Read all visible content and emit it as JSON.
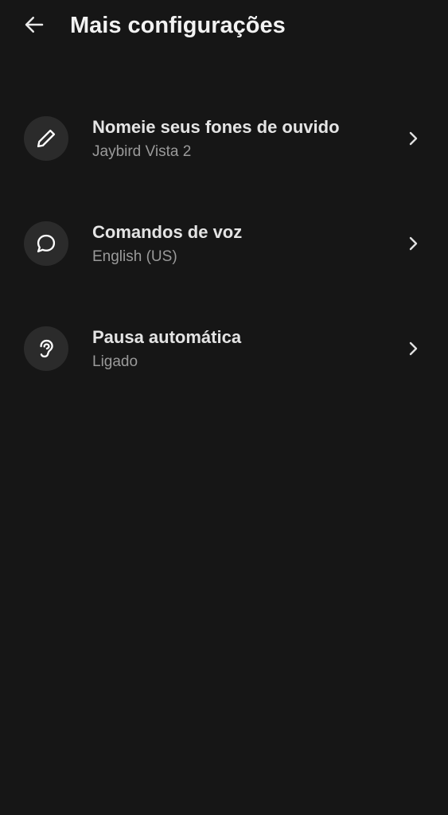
{
  "header": {
    "title": "Mais configurações",
    "back_icon": "arrow-left-icon"
  },
  "settings": {
    "items": [
      {
        "title": "Nomeie seus fones de ouvido",
        "subtitle": "Jaybird Vista 2",
        "icon": "pencil-icon"
      },
      {
        "title": "Comandos de voz",
        "subtitle": "English (US)",
        "icon": "speech-bubble-icon"
      },
      {
        "title": "Pausa automática",
        "subtitle": "Ligado",
        "icon": "ear-icon"
      }
    ]
  },
  "colors": {
    "background": "#161616",
    "icon_circle": "#2b2b2b",
    "title_text": "#e4e4e4",
    "subtitle_text": "#9a9a9a"
  }
}
